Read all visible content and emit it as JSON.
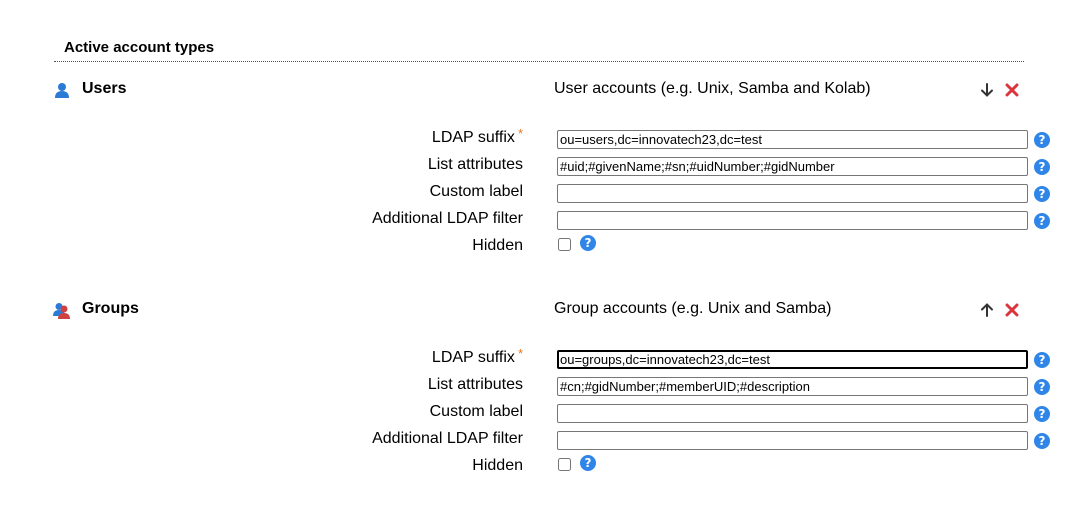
{
  "section": {
    "title": "Active account types"
  },
  "account_types": [
    {
      "name": "Users",
      "icon": "user-icon",
      "description": "User accounts (e.g. Unix, Samba and Kolab)",
      "move_icon": "arrow-down-icon",
      "fields": {
        "ldap_suffix_label": "LDAP suffix",
        "ldap_suffix_value": "ou=users,dc=innovatech23,dc=test",
        "list_attributes_label": "List attributes",
        "list_attributes_value": "#uid;#givenName;#sn;#uidNumber;#gidNumber",
        "custom_label_label": "Custom label",
        "custom_label_value": "",
        "additional_filter_label": "Additional LDAP filter",
        "additional_filter_value": "",
        "hidden_label": "Hidden",
        "hidden_checked": false
      }
    },
    {
      "name": "Groups",
      "icon": "group-icon",
      "description": "Group accounts (e.g. Unix and Samba)",
      "move_icon": "arrow-up-icon",
      "fields": {
        "ldap_suffix_label": "LDAP suffix",
        "ldap_suffix_value": "ou=groups,dc=innovatech23,dc=test",
        "list_attributes_label": "List attributes",
        "list_attributes_value": "#cn;#gidNumber;#memberUID;#description",
        "custom_label_label": "Custom label",
        "custom_label_value": "",
        "additional_filter_label": "Additional LDAP filter",
        "additional_filter_value": "",
        "hidden_label": "Hidden",
        "hidden_checked": false
      }
    }
  ],
  "required_marker": "*",
  "help_glyph": "?",
  "colors": {
    "help_button": "#2f86e8",
    "delete_icon": "#d9363e",
    "required_marker": "#e87722",
    "user_icon": "#2b7bd6",
    "group_icon": "#d04040"
  }
}
